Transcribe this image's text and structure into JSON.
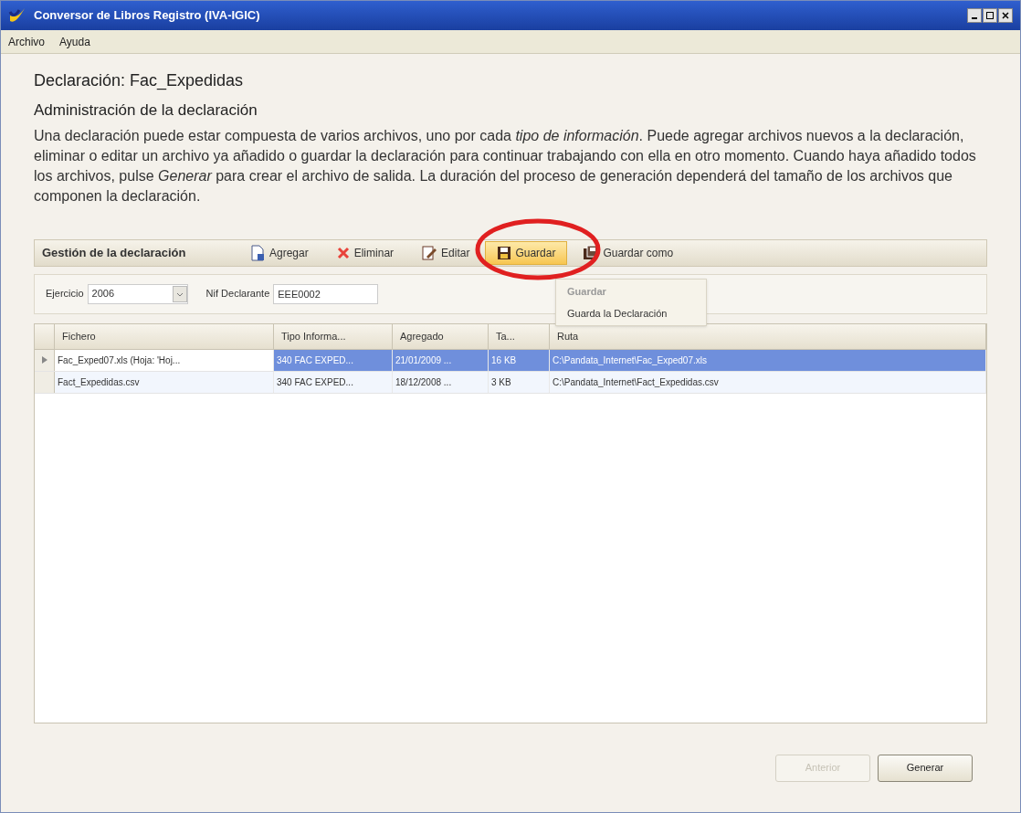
{
  "window": {
    "title": "Conversor de Libros Registro (IVA-IGIC)"
  },
  "menu": [
    "Archivo",
    "Ayuda"
  ],
  "heading": "Declaración: Fac_Expedidas",
  "subheading": "Administración de la declaración",
  "description": "Una declaración puede estar compuesta de varios archivos, uno por cada *tipo de información*. Puede agregar archivos nuevos a la declaración, eliminar o editar un archivo ya añadido o guardar la declaración para continuar trabajando con ella en otro momento. Cuando haya añadido todos los archivos, pulse *Generar* para crear el archivo de salida. La duración del proceso de generación dependerá del tamaño de los archivos que componen la declaración.",
  "toolbar": {
    "title": "Gestión de la declaración",
    "buttons": [
      {
        "kind": "add",
        "label": "Agregar",
        "hovered": false
      },
      {
        "kind": "delete",
        "label": "Eliminar",
        "hovered": false
      },
      {
        "kind": "edit",
        "label": "Editar",
        "hovered": false
      },
      {
        "kind": "save",
        "label": "Guardar",
        "hovered": true
      },
      {
        "kind": "saveas",
        "label": "Guardar como",
        "hovered": false
      }
    ]
  },
  "params": {
    "ejercicio_label": "Ejercicio",
    "ejercicio": "2006",
    "nif_label": "Nif Declarante",
    "nif": "EEE0002"
  },
  "tooltip": {
    "title": "Guardar",
    "text": "Guarda la Declaración"
  },
  "table": {
    "columns": [
      "Fichero",
      "Tipo Informa...",
      "Agregado",
      "Ta...",
      "Ruta"
    ],
    "rows": [
      {
        "selected": true,
        "cells": [
          "Fac_Exped07.xls (Hoja: 'Hoj...",
          "340 FAC EXPED...",
          "21/01/2009 ...",
          "16 KB",
          "C:\\Pandata_Internet\\Fac_Exped07.xls"
        ]
      },
      {
        "selected": false,
        "cells": [
          "Fact_Expedidas.csv",
          "340 FAC EXPED...",
          "18/12/2008 ...",
          "3 KB",
          "C:\\Pandata_Internet\\Fact_Expedidas.csv"
        ]
      }
    ]
  },
  "buttons": [
    {
      "label": "Anterior",
      "disabled": true
    },
    {
      "label": "Generar",
      "disabled": false
    }
  ]
}
